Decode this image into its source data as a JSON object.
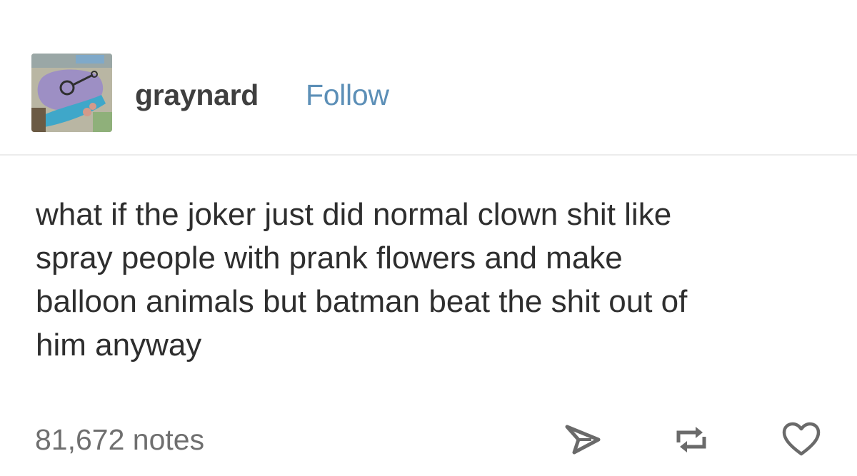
{
  "post": {
    "author": {
      "username": "graynard",
      "follow_label": "Follow"
    },
    "body_lines": [
      "what if the joker just did normal clown shit like",
      "spray people with prank flowers and make",
      "balloon animals but batman beat the shit out of",
      "him anyway"
    ],
    "footer": {
      "notes_label": "81,672 notes",
      "icons": [
        "share-icon",
        "reblog-icon",
        "heart-icon"
      ]
    }
  },
  "colors": {
    "follow_link": "#5c8fb7",
    "text": "#2e2e2e",
    "notes": "#6f6f6f",
    "icon": "#6a6a6a",
    "divider": "#ececec"
  }
}
